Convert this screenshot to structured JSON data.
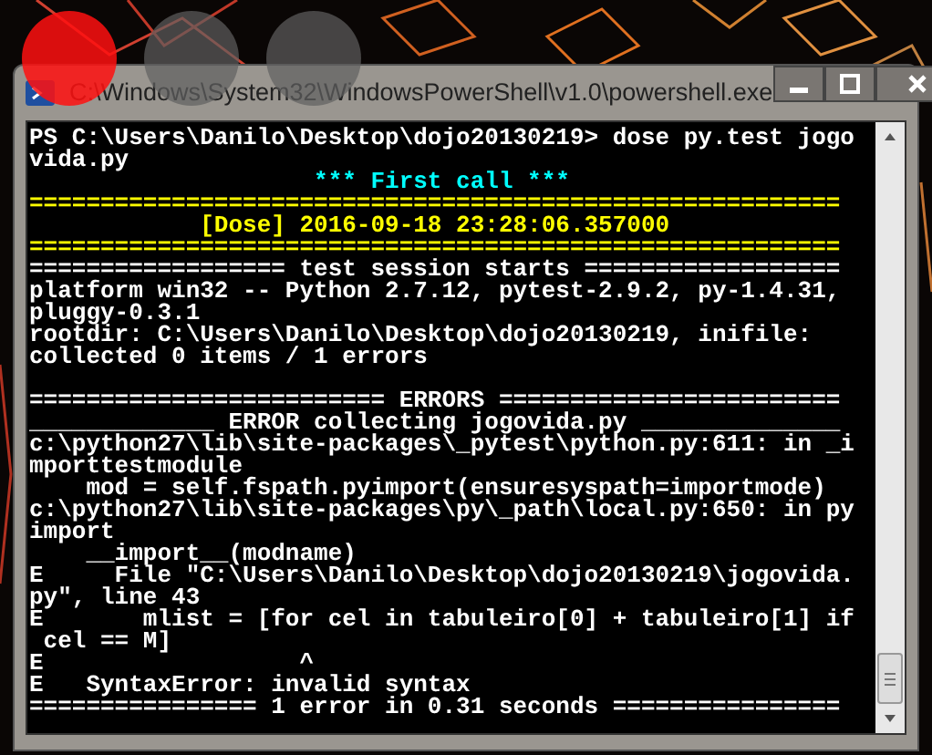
{
  "window": {
    "title": "C:\\Windows\\System32\\WindowsPowerShell\\v1.0\\powershell.exe",
    "controls": [
      {
        "kind": "minimize"
      },
      {
        "kind": "maximize"
      },
      {
        "kind": "close"
      }
    ]
  },
  "console": {
    "lines": [
      {
        "text": "PS C:\\Users\\Danilo\\Desktop\\dojo20130219> dose py.test jogo",
        "color": "#ffffff"
      },
      {
        "text": "vida.py",
        "color": "#ffffff"
      },
      {
        "text": "                    *** First call ***",
        "color": "#00ffff"
      },
      {
        "text": "=========================================================",
        "color": "#ffff00"
      },
      {
        "text": "            [Dose] 2016-09-18 23:28:06.357000",
        "color": "#ffff00"
      },
      {
        "text": "=========================================================",
        "color": "#ffff00"
      },
      {
        "text": "================== test session starts ==================",
        "color": "#ffffff"
      },
      {
        "text": "platform win32 -- Python 2.7.12, pytest-2.9.2, py-1.4.31,",
        "color": "#ffffff"
      },
      {
        "text": "pluggy-0.3.1",
        "color": "#ffffff"
      },
      {
        "text": "rootdir: C:\\Users\\Danilo\\Desktop\\dojo20130219, inifile:",
        "color": "#ffffff"
      },
      {
        "text": "collected 0 items / 1 errors",
        "color": "#ffffff"
      },
      {
        "text": "========================= ERRORS ========================",
        "color": "#ffffff",
        "blank_before": true
      },
      {
        "text": "_____________ ERROR collecting jogovida.py ______________",
        "color": "#ffffff"
      },
      {
        "text": "c:\\python27\\lib\\site-packages\\_pytest\\python.py:611: in _i",
        "color": "#ffffff"
      },
      {
        "text": "mporttestmodule",
        "color": "#ffffff"
      },
      {
        "text": "    mod = self.fspath.pyimport(ensuresyspath=importmode)",
        "color": "#ffffff"
      },
      {
        "text": "c:\\python27\\lib\\site-packages\\py\\_path\\local.py:650: in py",
        "color": "#ffffff"
      },
      {
        "text": "import",
        "color": "#ffffff"
      },
      {
        "text": "    __import__(modname)",
        "color": "#ffffff"
      },
      {
        "text": "E     File \"C:\\Users\\Danilo\\Desktop\\dojo20130219\\jogovida.",
        "color": "#ffffff"
      },
      {
        "text": "py\", line 43",
        "color": "#ffffff"
      },
      {
        "text": "E       mlist = [for cel in tabuleiro[0] + tabuleiro[1] if",
        "color": "#ffffff"
      },
      {
        "text": " cel == M]",
        "color": "#ffffff"
      },
      {
        "text": "E                  ^",
        "color": "#ffffff"
      },
      {
        "text": "E   SyntaxError: invalid syntax",
        "color": "#ffffff"
      },
      {
        "text": "================ 1 error in 0.31 seconds ================",
        "color": "#ffffff"
      }
    ]
  }
}
